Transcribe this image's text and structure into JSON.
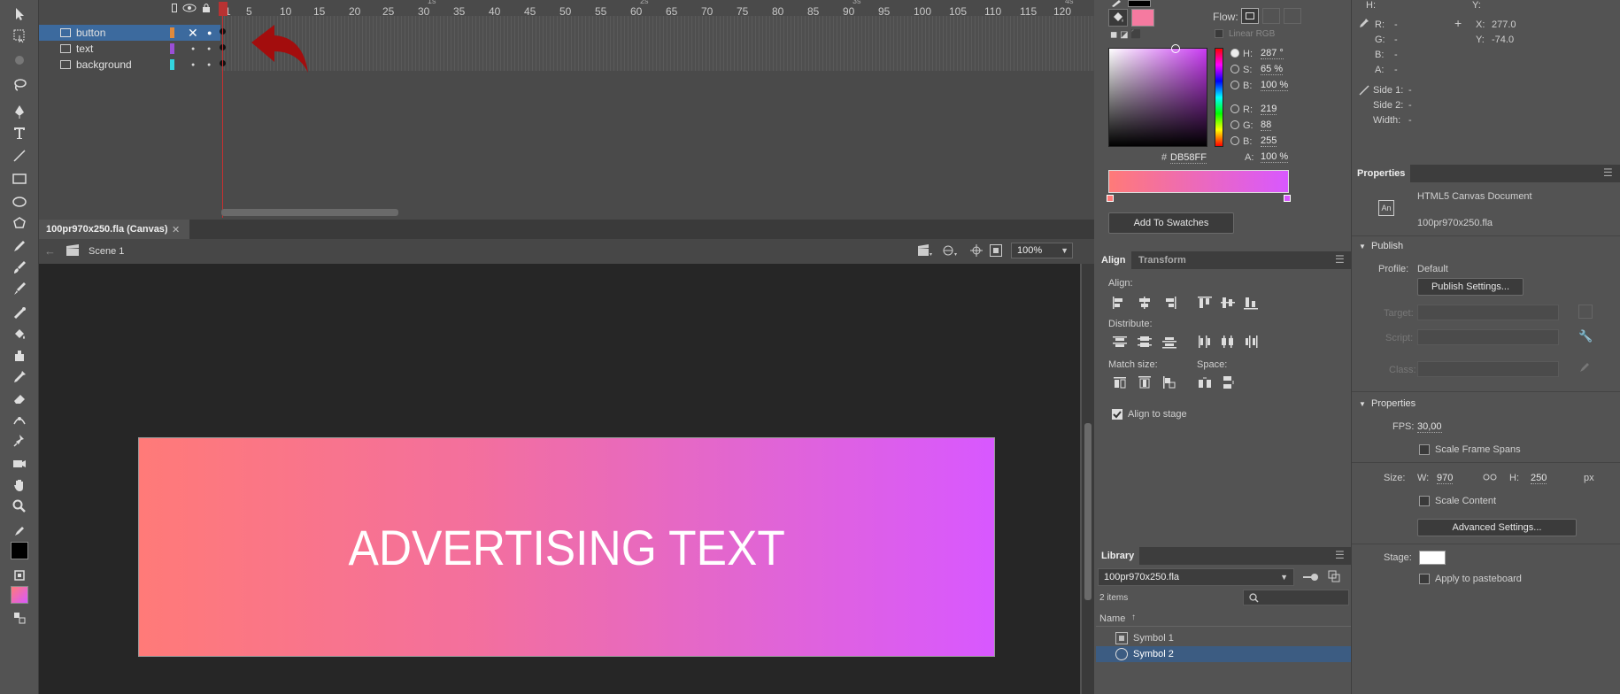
{
  "timeline": {
    "layers": [
      {
        "name": "button",
        "color": "#e08a3c",
        "selected": true
      },
      {
        "name": "text",
        "color": "#9a4fd6",
        "selected": false
      },
      {
        "name": "background",
        "color": "#33d6e0",
        "selected": false
      }
    ],
    "ruler": [
      "1",
      "5",
      "10",
      "15",
      "20",
      "25",
      "30",
      "35",
      "40",
      "45",
      "50",
      "55",
      "60",
      "65",
      "70",
      "75",
      "80",
      "85",
      "90",
      "95",
      "100",
      "105",
      "110",
      "115",
      "120"
    ],
    "sec_marks": [
      "1s",
      "2s",
      "3s",
      "4s"
    ]
  },
  "document": {
    "tab_label": "100pr970x250.fla (Canvas)",
    "scene_label": "Scene 1",
    "zoom": "100%",
    "banner_text": "ADVERTISING TEXT"
  },
  "color": {
    "flow_label": "Flow:",
    "linear_rgb": "Linear RGB",
    "h_label": "H:",
    "h_value": "287 °",
    "s_label": "S:",
    "s_value": "65 %",
    "b_label": "B:",
    "b_value": "100 %",
    "r_label": "R:",
    "r_value": "219",
    "g_label": "G:",
    "g_value": "88",
    "bl_label": "B:",
    "bl_value": "255",
    "a_label": "A:",
    "a_value": "100 %",
    "hex_prefix": "#",
    "hex": "DB58FF",
    "add_to_swatches": "Add To Swatches",
    "fill_color": "#f57aa0",
    "gradient_start": "#ff7a78",
    "gradient_end": "#d858ff"
  },
  "align": {
    "tab_align": "Align",
    "tab_transform": "Transform",
    "align_label": "Align:",
    "distribute_label": "Distribute:",
    "match_size_label": "Match size:",
    "space_label": "Space:",
    "align_to_stage": "Align to stage"
  },
  "library": {
    "tab": "Library",
    "file": "100pr970x250.fla",
    "count": "2 items",
    "name_header": "Name",
    "items": [
      "Symbol 1",
      "Symbol 2"
    ]
  },
  "info": {
    "h_label": "H:",
    "y_label": "Y:",
    "r_label": "R:",
    "r_value": "-",
    "g_label": "G:",
    "g_value": "-",
    "b_label": "B:",
    "b_value": "-",
    "a_label": "A:",
    "a_value": "-",
    "x_label": "X:",
    "x_value": "277.0",
    "y2_label": "Y:",
    "y2_value": "-74.0",
    "side1_label": "Side 1:",
    "side1_value": "-",
    "side2_label": "Side 2:",
    "side2_value": "-",
    "width_label": "Width:",
    "width_value": "-"
  },
  "properties": {
    "tab": "Properties",
    "doc_type": "HTML5 Canvas Document",
    "doc_file": "100pr970x250.fla",
    "an_badge": "An",
    "publish_header": "Publish",
    "profile_label": "Profile:",
    "profile_value": "Default",
    "publish_settings": "Publish Settings...",
    "target_label": "Target:",
    "script_label": "Script:",
    "class_label": "Class:",
    "properties_header": "Properties",
    "fps_label": "FPS:",
    "fps_value": "30,00",
    "scale_frame_spans": "Scale Frame Spans",
    "size_label": "Size:",
    "w_label": "W:",
    "w_value": "970",
    "h_label": "H:",
    "h_value": "250",
    "px": "px",
    "scale_content": "Scale Content",
    "advanced_settings": "Advanced Settings...",
    "stage_label": "Stage:",
    "apply_to_pasteboard": "Apply to pasteboard"
  }
}
